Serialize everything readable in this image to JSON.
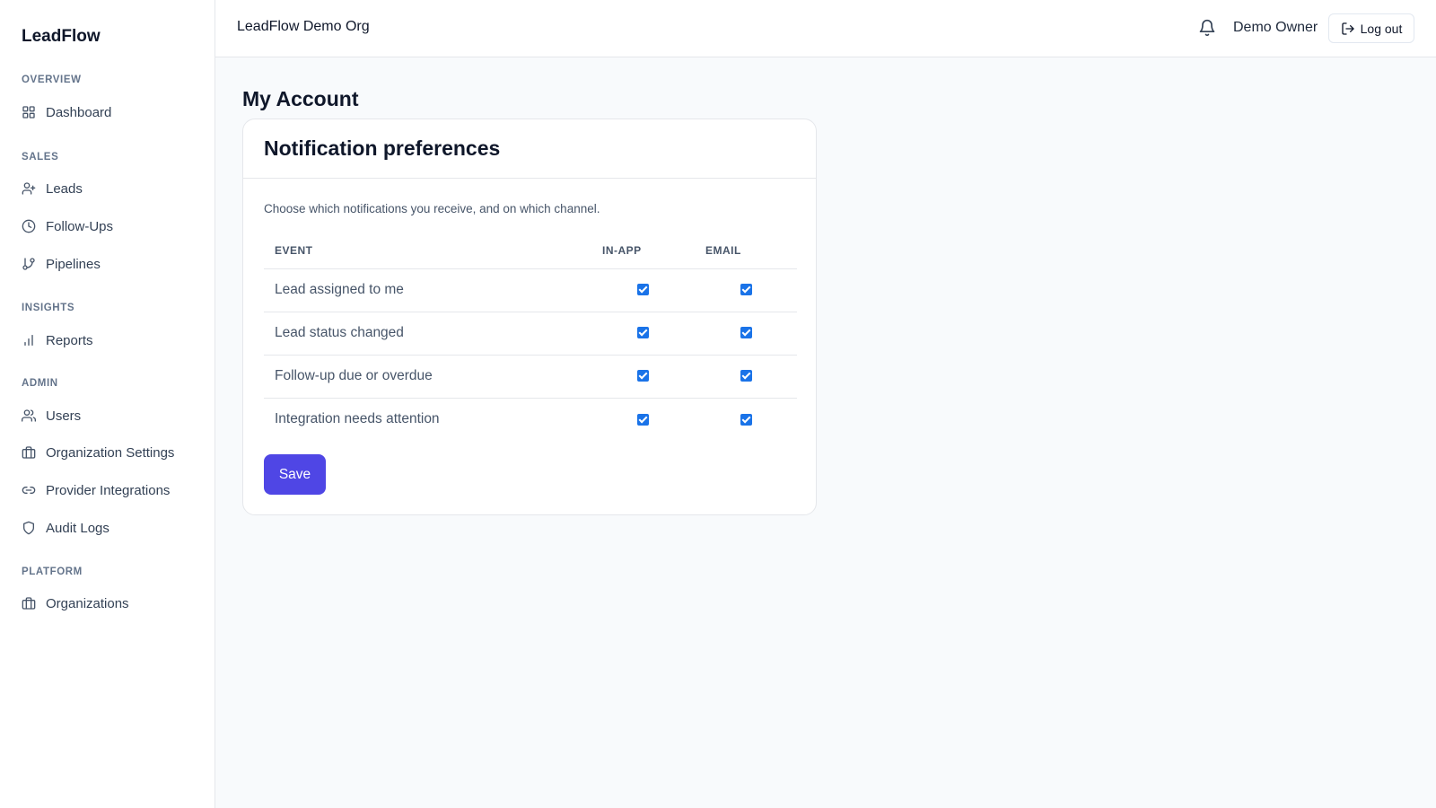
{
  "sidebar": {
    "brand": "LeadFlow",
    "sections": [
      {
        "label": "OVERVIEW",
        "items": [
          {
            "label": "Dashboard",
            "icon": "grid-icon"
          }
        ]
      },
      {
        "label": "SALES",
        "items": [
          {
            "label": "Leads",
            "icon": "user-plus-icon"
          },
          {
            "label": "Follow-Ups",
            "icon": "clock-icon"
          },
          {
            "label": "Pipelines",
            "icon": "git-branch-icon"
          }
        ]
      },
      {
        "label": "INSIGHTS",
        "items": [
          {
            "label": "Reports",
            "icon": "bar-chart-icon"
          }
        ]
      },
      {
        "label": "ADMIN",
        "items": [
          {
            "label": "Users",
            "icon": "users-icon"
          },
          {
            "label": "Organization Settings",
            "icon": "briefcase-icon"
          },
          {
            "label": "Provider Integrations",
            "icon": "link-icon"
          },
          {
            "label": "Audit Logs",
            "icon": "shield-icon"
          }
        ]
      },
      {
        "label": "PLATFORM",
        "items": [
          {
            "label": "Organizations",
            "icon": "briefcase-icon"
          }
        ]
      }
    ]
  },
  "topbar": {
    "org_name": "LeadFlow Demo Org",
    "user_name": "Demo Owner",
    "logout_label": "Log out"
  },
  "page": {
    "title": "My Account"
  },
  "card": {
    "title": "Notification preferences",
    "description": "Choose which notifications you receive, and on which channel.",
    "columns": [
      "EVENT",
      "IN-APP",
      "EMAIL"
    ],
    "rows": [
      {
        "event": "Lead assigned to me",
        "in_app": true,
        "email": true
      },
      {
        "event": "Lead status changed",
        "in_app": true,
        "email": true
      },
      {
        "event": "Follow-up due or overdue",
        "in_app": true,
        "email": true
      },
      {
        "event": "Integration needs attention",
        "in_app": true,
        "email": true
      }
    ],
    "save_label": "Save"
  },
  "colors": {
    "accent": "#4f46e5",
    "checkbox": "#1a73e8"
  }
}
